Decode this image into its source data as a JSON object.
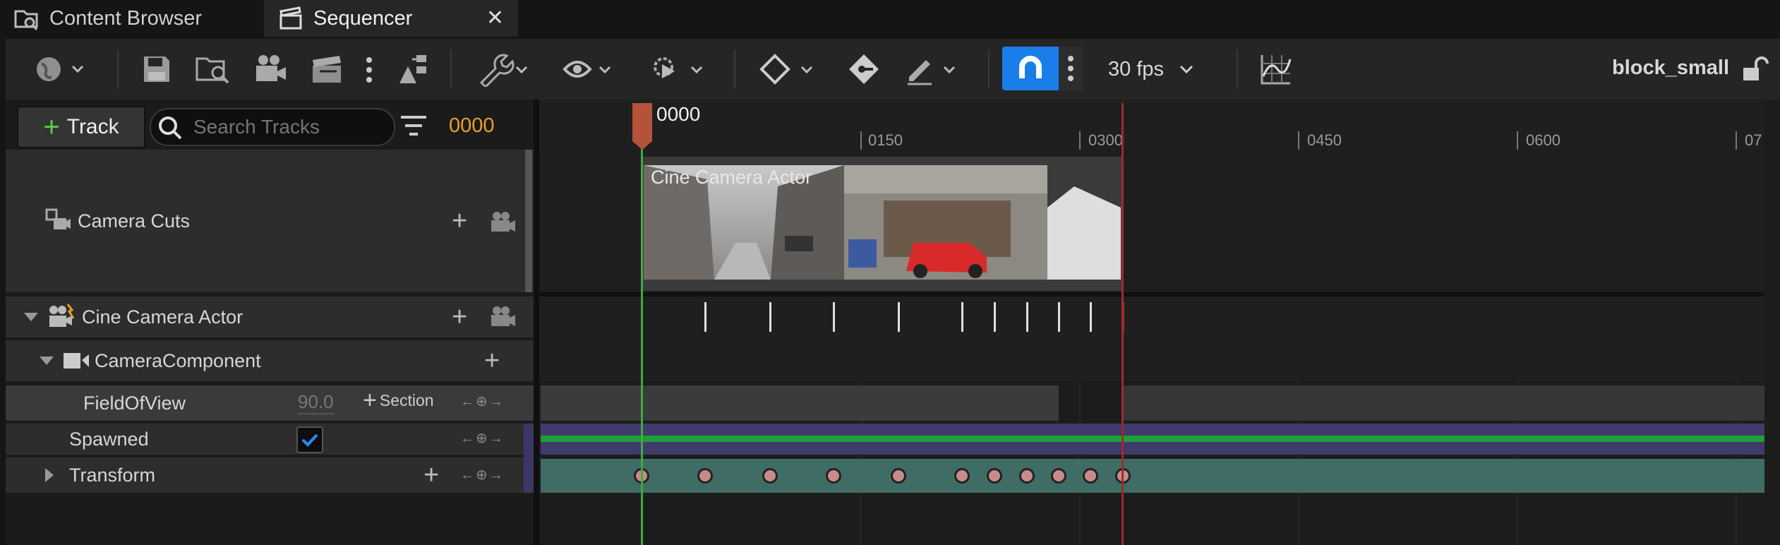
{
  "tabs": [
    {
      "label": "Content Browser",
      "icon": "folder-search-icon",
      "active": false
    },
    {
      "label": "Sequencer",
      "icon": "clapperboard-icon",
      "active": true
    }
  ],
  "toolbar": {
    "fps_label": "30 fps",
    "sequence_name": "block_small",
    "snap_active_color": "#1a7ee8"
  },
  "left_panel": {
    "add_track_label": "Track",
    "search_placeholder": "Search Tracks",
    "current_frame": "0000",
    "rows": {
      "camera_cuts": "Camera Cuts",
      "cine_camera_actor": "Cine Camera Actor",
      "camera_component": "CameraComponent",
      "field_of_view": {
        "label": "FieldOfView",
        "value": "90.0",
        "section_label": "Section"
      },
      "spawned": {
        "label": "Spawned",
        "checked": true
      },
      "transform": "Transform"
    }
  },
  "timeline": {
    "playhead_label": "0000",
    "ticks": [
      "0150",
      "0300",
      "0450",
      "0600",
      "07"
    ],
    "camera_clip_label": "Cine Camera Actor",
    "colors": {
      "playhead": "#b5533a",
      "start_marker": "#3faa3f",
      "end_marker": "#a02a2a",
      "spawned_track": "#1f9e3a",
      "transform_track": "#3f6d66"
    }
  }
}
